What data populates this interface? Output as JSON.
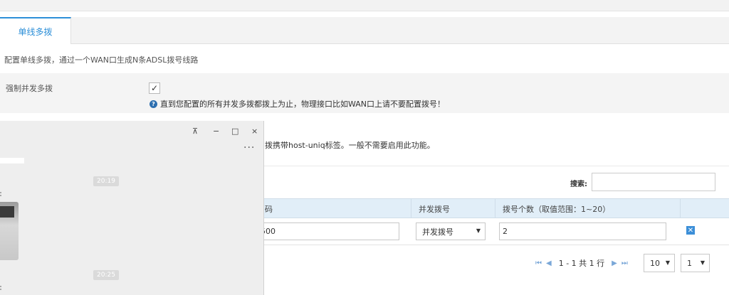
{
  "tabs": [
    {
      "label": "单线多拨",
      "active": true
    }
  ],
  "description": "配置单线多拨，通过一个WAN口生成N条ADSL拨号线路",
  "force": {
    "label": "强制并发多拨",
    "checked": true,
    "note": "直到您配置的所有并发多拨都拨上为止，物理接口比如WAN口上请不要配置拨号！"
  },
  "host_uniq_note": "拨携带host-uniq标签。一般不需要启用此功能。",
  "search": {
    "label": "搜索:",
    "value": ""
  },
  "table": {
    "columns": [
      "码",
      "并发拨号",
      "拨号个数（取值范围：1~20）"
    ],
    "rows": [
      {
        "line": "500",
        "mode": "并发拨号",
        "count": "2"
      }
    ]
  },
  "pager": {
    "info": "1 - 1 共 1 行",
    "page_size": "10",
    "page": "1"
  },
  "chat": {
    "controls": [
      "⊼",
      "−",
      "□",
      "×"
    ],
    "more": "...",
    "times": [
      "20:19",
      "20:25"
    ]
  },
  "colors": {
    "accent": "#2d8fd8",
    "header_bg": "#e1eef8"
  }
}
